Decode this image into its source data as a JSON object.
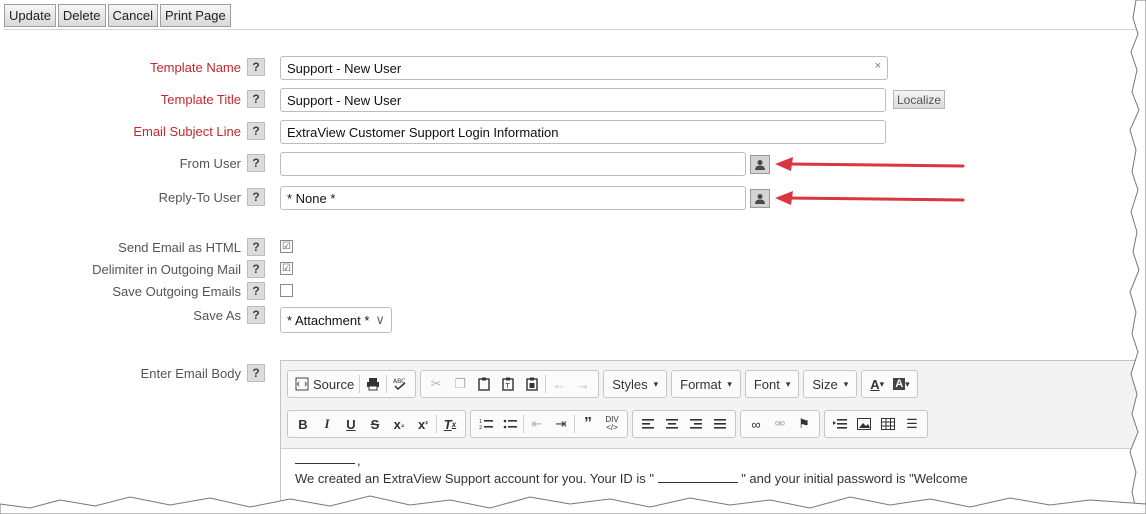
{
  "toolbar": {
    "update": "Update",
    "delete": "Delete",
    "cancel": "Cancel",
    "print": "Print Page"
  },
  "fields": {
    "template_name": {
      "label": "Template Name",
      "value": "Support - New User",
      "clear": "×"
    },
    "template_title": {
      "label": "Template Title",
      "value": "Support - New User",
      "localize": "Localize"
    },
    "email_subject": {
      "label": "Email Subject Line",
      "value": "ExtraView Customer Support Login Information"
    },
    "from_user": {
      "label": "From User",
      "value": ""
    },
    "reply_to": {
      "label": "Reply-To User",
      "value": "* None *"
    },
    "send_html": {
      "label": "Send Email as HTML",
      "checked": "☑"
    },
    "delimiter": {
      "label": "Delimiter in Outgoing Mail",
      "checked": "☑"
    },
    "save_outgoing": {
      "label": "Save Outgoing Emails",
      "checked": ""
    },
    "save_as": {
      "label": "Save As",
      "value": "* Attachment *",
      "arrow": "∨"
    },
    "email_body": {
      "label": "Enter Email Body"
    }
  },
  "help": "?",
  "editor": {
    "source": "Source",
    "styles": "Styles",
    "format": "Format",
    "font": "Font",
    "size": "Size",
    "dropdown": "▾",
    "body_comma": ",",
    "body_text": "We created an ExtraView Support account for you. Your ID is \"",
    "body_text_mid": "\" and your initial password is \"Welcome"
  },
  "colors": {
    "required": "#c0282d",
    "arrow": "#d9363e"
  }
}
